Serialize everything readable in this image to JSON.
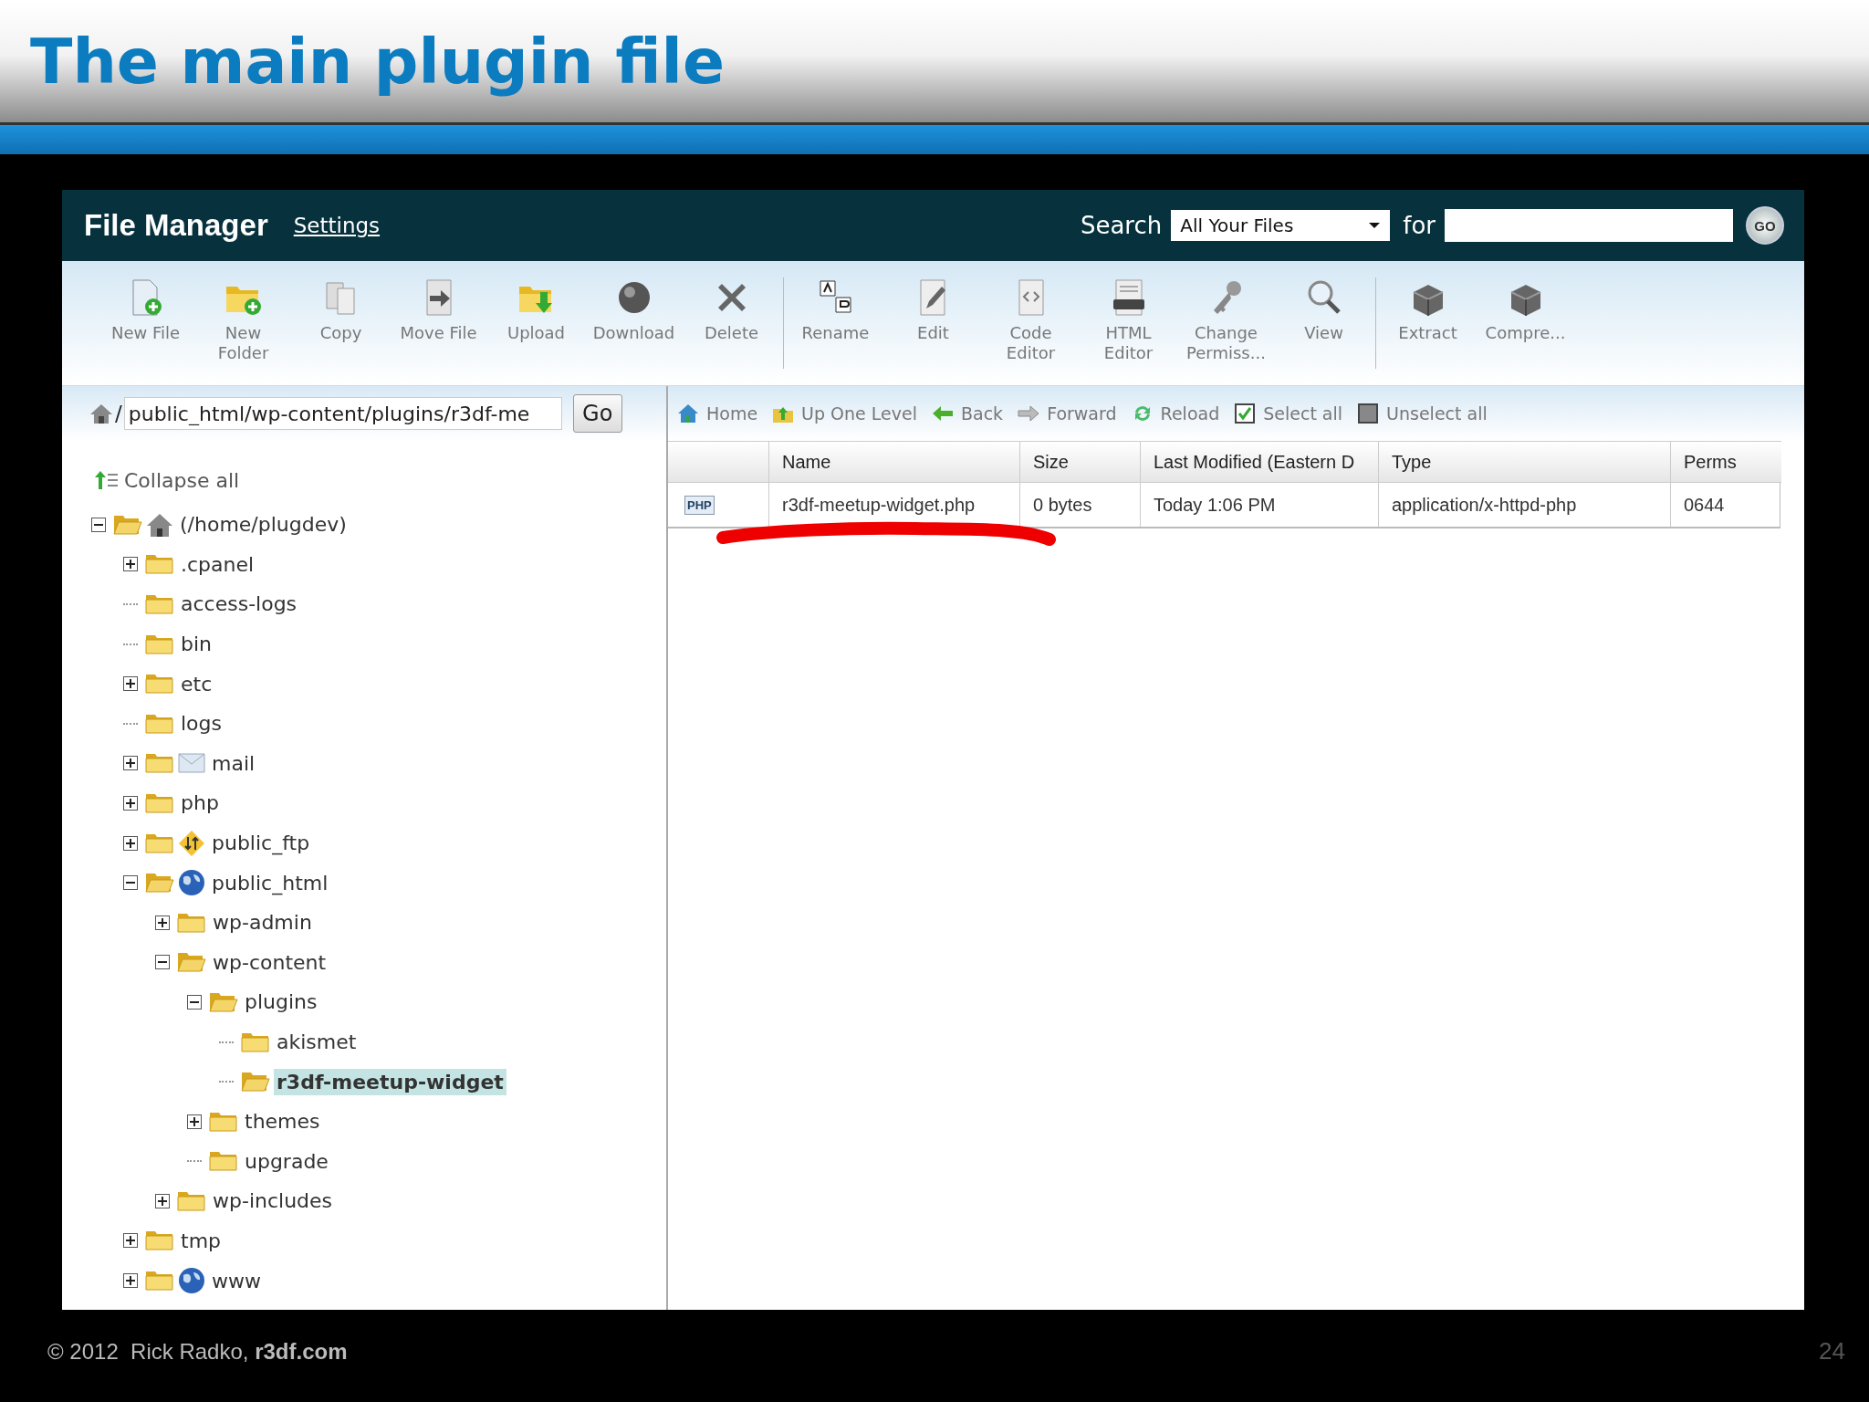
{
  "slide": {
    "title": "The main plugin file",
    "copyright": "© 2012  Rick Radko, **r3df.com**",
    "page": "24"
  },
  "header": {
    "title": "File Manager",
    "settings_link": "Settings",
    "search_label": "Search",
    "scope": "All Your Files",
    "for_label": "for",
    "go_button": "GO"
  },
  "toolbar": {
    "groups": [
      [
        {
          "kind": "new-file",
          "label": [
            "New File"
          ]
        },
        {
          "kind": "new-folder",
          "label": [
            "New",
            "Folder"
          ]
        },
        {
          "kind": "copy",
          "label": [
            "Copy"
          ]
        },
        {
          "kind": "move",
          "label": [
            "Move File"
          ]
        },
        {
          "kind": "upload",
          "label": [
            "Upload"
          ]
        },
        {
          "kind": "download",
          "label": [
            "Download"
          ]
        },
        {
          "kind": "delete",
          "label": [
            "Delete"
          ]
        }
      ],
      [
        {
          "kind": "rename",
          "label": [
            "Rename"
          ]
        },
        {
          "kind": "edit",
          "label": [
            "Edit"
          ]
        },
        {
          "kind": "code",
          "label": [
            "Code",
            "Editor"
          ]
        },
        {
          "kind": "html",
          "label": [
            "HTML",
            "Editor"
          ]
        },
        {
          "kind": "perms",
          "label": [
            "Change",
            "Permiss..."
          ]
        },
        {
          "kind": "view",
          "label": [
            "View"
          ]
        }
      ],
      [
        {
          "kind": "extract",
          "label": [
            "Extract"
          ]
        },
        {
          "kind": "compress",
          "label": [
            "Compre..."
          ]
        }
      ]
    ]
  },
  "path_bar": {
    "root": "/",
    "value": "public_html/wp-content/plugins/r3df-me",
    "go_button": "Go"
  },
  "tree": {
    "collapse_all": "Collapse all",
    "items": [
      {
        "label": "(/home/plugdev)",
        "kind": "home",
        "toggle": true,
        "expanded": true,
        "selected": false,
        "children": [
          {
            "label": ".cpanel",
            "kind": "folder",
            "toggle": true,
            "expanded": false,
            "selected": false
          },
          {
            "label": "access-logs",
            "kind": "folder",
            "toggle": false,
            "selected": false
          },
          {
            "label": "bin",
            "kind": "folder",
            "toggle": false,
            "selected": false
          },
          {
            "label": "etc",
            "kind": "folder",
            "toggle": true,
            "expanded": false,
            "selected": false
          },
          {
            "label": "logs",
            "kind": "folder",
            "toggle": false,
            "selected": false
          },
          {
            "label": "mail",
            "kind": "mail",
            "toggle": true,
            "expanded": false,
            "selected": false
          },
          {
            "label": "php",
            "kind": "folder",
            "toggle": true,
            "expanded": false,
            "selected": false
          },
          {
            "label": "public_ftp",
            "kind": "ftp",
            "toggle": true,
            "expanded": false,
            "selected": false
          },
          {
            "label": "public_html",
            "kind": "web",
            "toggle": true,
            "expanded": true,
            "selected": false,
            "children": [
              {
                "label": "wp-admin",
                "kind": "folder",
                "toggle": true,
                "expanded": false,
                "selected": false
              },
              {
                "label": "wp-content",
                "kind": "folder",
                "toggle": true,
                "expanded": true,
                "selected": false,
                "children": [
                  {
                    "label": "plugins",
                    "kind": "folder",
                    "toggle": true,
                    "expanded": true,
                    "selected": false,
                    "children": [
                      {
                        "label": "akismet",
                        "kind": "folder",
                        "toggle": false,
                        "selected": false
                      },
                      {
                        "label": "r3df-meetup-widget",
                        "kind": "folder",
                        "toggle": false,
                        "selected": true
                      }
                    ]
                  },
                  {
                    "label": "themes",
                    "kind": "folder",
                    "toggle": true,
                    "expanded": false,
                    "selected": false
                  },
                  {
                    "label": "upgrade",
                    "kind": "folder",
                    "toggle": false,
                    "selected": false
                  }
                ]
              },
              {
                "label": "wp-includes",
                "kind": "folder",
                "toggle": true,
                "expanded": false,
                "selected": false
              }
            ]
          },
          {
            "label": "tmp",
            "kind": "folder",
            "toggle": true,
            "expanded": false,
            "selected": false
          },
          {
            "label": "www",
            "kind": "web",
            "toggle": true,
            "expanded": false,
            "selected": false
          }
        ]
      }
    ]
  },
  "nav": [
    {
      "kind": "home",
      "label": "Home"
    },
    {
      "kind": "up",
      "label": "Up One Level"
    },
    {
      "kind": "back",
      "label": "Back"
    },
    {
      "kind": "forward",
      "label": "Forward"
    },
    {
      "kind": "reload",
      "label": "Reload"
    },
    {
      "kind": "select",
      "label": "Select all"
    },
    {
      "kind": "unselect",
      "label": "Unselect all"
    }
  ],
  "table": {
    "columns": [
      "Name",
      "Size",
      "Last Modified (Eastern D",
      "Type",
      "Perms"
    ],
    "rows": [
      {
        "icon_label": "PHP",
        "cells": [
          "r3df-meetup-widget.php",
          "0 bytes",
          "Today 1:06 PM",
          "application/x-httpd-php",
          "0644"
        ]
      }
    ]
  }
}
